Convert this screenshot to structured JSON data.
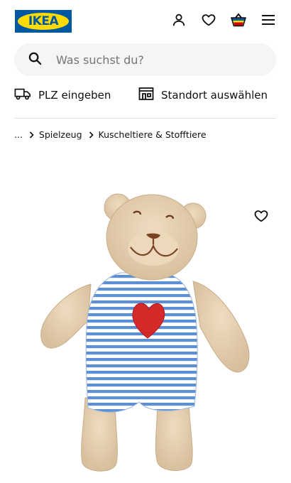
{
  "header": {
    "logo_text": "IKEA",
    "icons": [
      "user-icon",
      "heart-icon",
      "basket-icon",
      "menu-icon"
    ]
  },
  "search": {
    "placeholder": "Was suchst du?",
    "value": ""
  },
  "delivery": {
    "plz_label": "PLZ eingeben",
    "store_label": "Standort auswählen"
  },
  "breadcrumb": {
    "ellipsis": "...",
    "items": [
      "Spielzeug",
      "Kuscheltiere & Stofftiere"
    ]
  },
  "product": {
    "image": "teddy-bear-plush-striped-outfit"
  },
  "colors": {
    "ikea_blue": "#0058a3",
    "ikea_yellow": "#ffdb00",
    "search_bg": "#f5f5f5",
    "text": "#111111"
  }
}
